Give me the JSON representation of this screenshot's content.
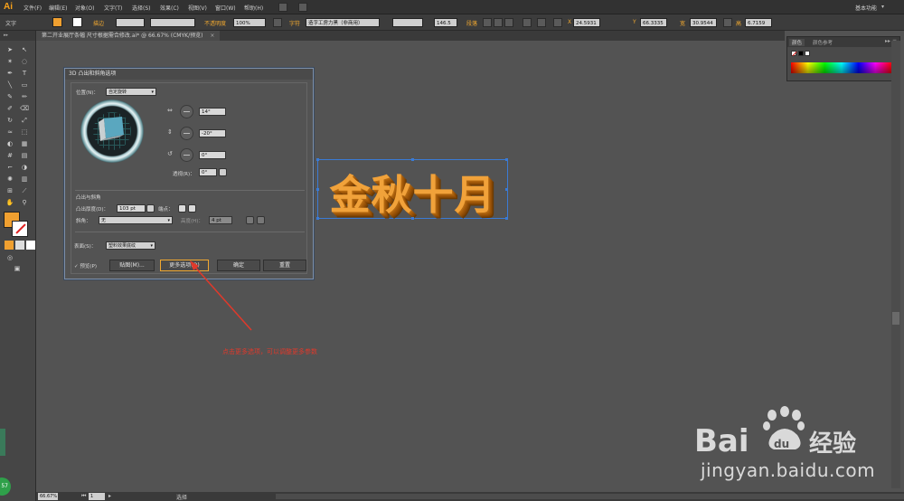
{
  "app": {
    "logo": "Ai"
  },
  "menu": {
    "items": [
      "文件(F)",
      "编辑(E)",
      "对象(O)",
      "文字(T)",
      "选择(S)",
      "效果(C)",
      "视图(V)",
      "窗口(W)",
      "帮助(H)"
    ],
    "workspace": "基本功能"
  },
  "control_bar": {
    "object_type": "文字",
    "stroke_label": "描边",
    "opacity_label": "不透明度",
    "opacity_value": "100%",
    "character_label": "字符",
    "font_name": "造字工房力黑（非商用）",
    "font_size": "146.5",
    "paragraph_label": "段落",
    "x_label": "X",
    "x_value": "24.5931",
    "y_label": "Y",
    "y_value": "66.3335",
    "w_label": "宽",
    "w_value": "30.9544",
    "h_label": "高",
    "h_value": "6.7159",
    "fill_color": "#f0a030"
  },
  "document_tab": {
    "title": "第二开业展厅条幅 尺寸根据需合修改.ai* @ 66.67% (CMYK/预览)",
    "close": "×"
  },
  "color_panel": {
    "tab_active": "颜色",
    "tab_other": "颜色参考",
    "menu_icon": "▸▸ ≡"
  },
  "artwork": {
    "text": "金秋十月",
    "fill": "#f1a23a"
  },
  "dialog": {
    "title": "3D 凸出和斜角选项",
    "position_label": "位置(N)：",
    "position_value": "自定旋转",
    "rot_x": "14°",
    "rot_y": "-20°",
    "rot_z": "0°",
    "perspective_label": "透视(R)：",
    "perspective_value": "0°",
    "extrude_section": "凸出与斜角",
    "depth_label": "凸出厚度(D)：",
    "depth_value": "103 pt",
    "cap_label": "端点：",
    "bevel_label": "斜角：",
    "bevel_value": "无",
    "height_label": "高度(H)：",
    "height_value": "4 pt",
    "surface_label": "表面(S)：",
    "surface_value": "塑料效果底纹",
    "preview_label": "✓ 预览(P)",
    "map_button": "贴图(M)...",
    "more_options_button": "更多选项(O)",
    "ok_button": "确定",
    "reset_button": "重置"
  },
  "annotation": {
    "text": "点击更多选项，可以调整更多参数",
    "color": "#e0392b"
  },
  "status_bar": {
    "zoom": "66.67%",
    "page": "1",
    "tool": "选择"
  },
  "watermark": {
    "brand": "Baidu 经验",
    "url": "jingyan.baidu.com"
  }
}
